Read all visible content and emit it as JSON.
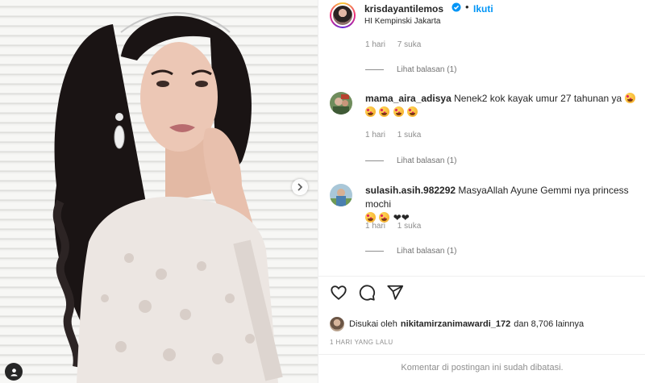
{
  "post": {
    "image_alt": "",
    "header": {
      "username": "krisdayantilemos",
      "separator": "•",
      "follow_label": "Ikuti",
      "location": "HI Kempinski Jakarta"
    },
    "first_meta": {
      "time": "1 hari",
      "likes": "7 suka"
    },
    "first_replies": "Lihat balasan (1)",
    "comments": [
      {
        "username": "mama_aira_adisya",
        "text": "Nenek2 kok kayak umur 27 tahunan ya",
        "time": "1 hari",
        "likes": "1 suka",
        "replies": "Lihat balasan (1)"
      },
      {
        "username": "sulasih.asih.982292",
        "text": "MasyaAllah Ayune Gemmi nya princess mochi",
        "time": "1 hari",
        "likes": "1 suka",
        "replies": "Lihat balasan (1)"
      }
    ],
    "likes_line": {
      "prefix": "Disukai oleh",
      "user": "nikitamirzanimawardi_172",
      "suffix": "dan 8,706 lainnya"
    },
    "timestamp": "1 HARI YANG LALU",
    "comments_closed": "Komentar di postingan ini sudah dibatasi.",
    "icons": [
      "heart-icon",
      "comment-icon",
      "share-icon",
      "chevron-right-icon",
      "verified-badge-icon"
    ],
    "colors": {
      "accent": "#0095f6",
      "text": "#262626",
      "muted": "#8e8e8e"
    }
  }
}
